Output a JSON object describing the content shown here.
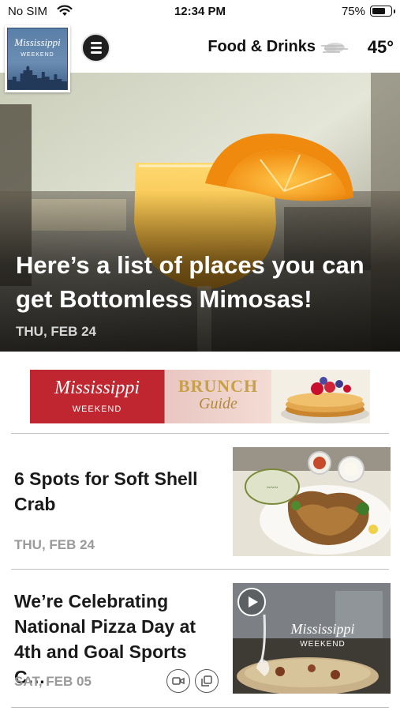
{
  "status_bar": {
    "carrier": "No SIM",
    "time": "12:34 PM",
    "battery_percent": "75%",
    "battery_level": 0.75
  },
  "header": {
    "logo": {
      "brand": "Mississippi",
      "sub": "WEEKEND"
    },
    "menu_icon": "hamburger-icon",
    "section_title": "Food & Drinks",
    "weather_icon": "wind-cloud-icon",
    "temperature": "45°"
  },
  "hero": {
    "title": "Here’s a list of places you can get Bottomless Mimosas!",
    "date": "THU, FEB 24"
  },
  "ad_banner": {
    "brand": "Mississippi",
    "sub": "WEEKEND",
    "brunch": "BRUNCH",
    "guide": "Guide"
  },
  "articles": [
    {
      "title": "6 Spots for Soft Shell Crab",
      "date": "THU, FEB 24"
    },
    {
      "title": "We’re Celebrating National Pizza Day at 4th and Goal Sports C…",
      "date": "SAT, FEB 05",
      "thumb_brand": "Mississippi",
      "thumb_sub": "WEEKEND",
      "icons": [
        "video-icon",
        "gallery-icon"
      ]
    }
  ],
  "colors": {
    "accent_red": "#c0262f",
    "text_dark": "#1a1a1a",
    "date_gray": "#9a9a9a"
  }
}
